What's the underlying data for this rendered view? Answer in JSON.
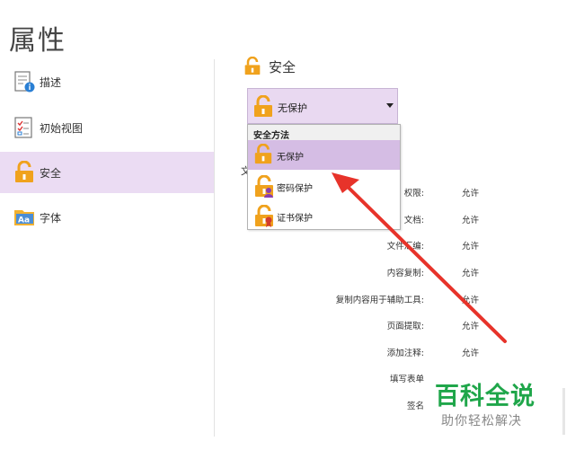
{
  "title": "属性",
  "sidebar": {
    "items": [
      {
        "label": "描述",
        "icon": "document-info-icon"
      },
      {
        "label": "初始视图",
        "icon": "checklist-icon"
      },
      {
        "label": "安全",
        "icon": "padlock-icon"
      },
      {
        "label": "字体",
        "icon": "font-icon"
      }
    ],
    "selected": "安全"
  },
  "section": {
    "title": "安全"
  },
  "security": {
    "method_value": "无保护",
    "dropdown": {
      "header": "安全方法",
      "options": [
        "无保护",
        "密码保护",
        "证书保护"
      ],
      "highlighted": "无保护"
    }
  },
  "document_label": "文",
  "permissions": [
    {
      "key": "权限:",
      "value": "允许"
    },
    {
      "key": "文档:",
      "value": "允许"
    },
    {
      "key": "文件汇编:",
      "value": "允许"
    },
    {
      "key": "内容复制:",
      "value": "允许"
    },
    {
      "key": "复制内容用于辅助工具:",
      "value": "允许"
    },
    {
      "key": "页面提取:",
      "value": "允许"
    },
    {
      "key": "添加注释:",
      "value": "允许"
    },
    {
      "key": "填写表单",
      "value": ""
    },
    {
      "key": "签名",
      "value": ""
    }
  ],
  "watermark": {
    "title": "百科全说",
    "subtitle": "助你轻松解决"
  },
  "colors": {
    "accent": "#e7332a",
    "selected_bg": "#ebdcf3",
    "lock": "#f0a21d",
    "watermark_green": "#1fa64a"
  }
}
